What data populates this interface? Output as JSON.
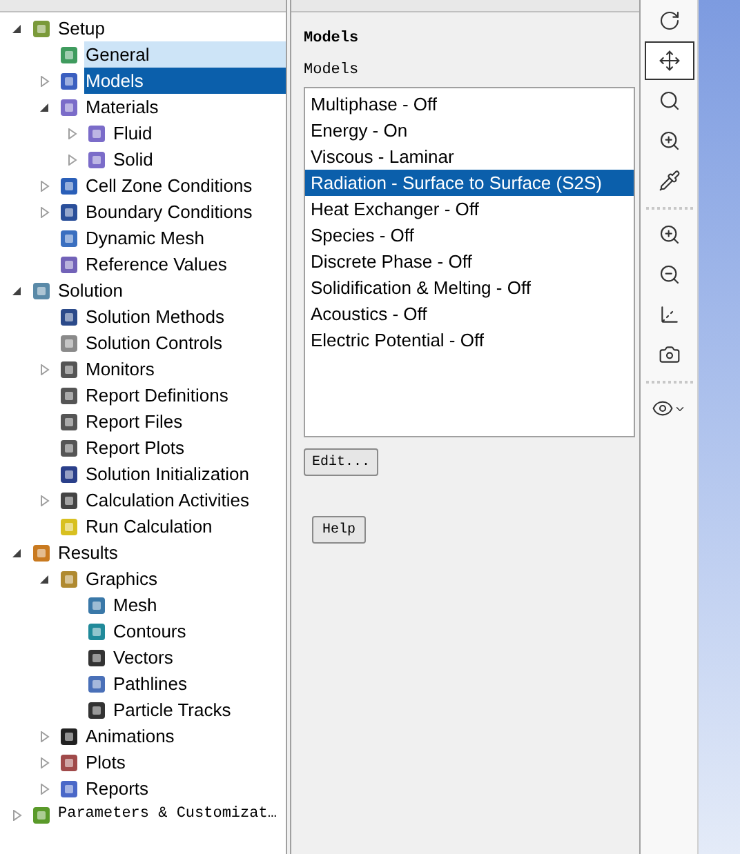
{
  "tree": [
    {
      "label": "Setup",
      "expanded": true,
      "selected": false,
      "hovered": false,
      "children": [
        {
          "label": "General",
          "selected": false,
          "hovered": true
        },
        {
          "label": "Models",
          "expanded": false,
          "selected": true,
          "hovered": false
        },
        {
          "label": "Materials",
          "expanded": true,
          "selected": false,
          "hovered": false,
          "children": [
            {
              "label": "Fluid",
              "expanded": false,
              "selected": false,
              "hovered": false
            },
            {
              "label": "Solid",
              "expanded": false,
              "selected": false,
              "hovered": false
            }
          ]
        },
        {
          "label": "Cell Zone Conditions",
          "expanded": false,
          "selected": false,
          "hovered": false
        },
        {
          "label": "Boundary Conditions",
          "expanded": false,
          "selected": false,
          "hovered": false
        },
        {
          "label": "Dynamic Mesh",
          "selected": false,
          "hovered": false
        },
        {
          "label": "Reference Values",
          "selected": false,
          "hovered": false
        }
      ]
    },
    {
      "label": "Solution",
      "expanded": true,
      "selected": false,
      "hovered": false,
      "children": [
        {
          "label": "Solution Methods",
          "selected": false,
          "hovered": false
        },
        {
          "label": "Solution Controls",
          "selected": false,
          "hovered": false
        },
        {
          "label": "Monitors",
          "expanded": false,
          "selected": false,
          "hovered": false
        },
        {
          "label": "Report Definitions",
          "selected": false,
          "hovered": false
        },
        {
          "label": "Report Files",
          "selected": false,
          "hovered": false
        },
        {
          "label": "Report Plots",
          "selected": false,
          "hovered": false
        },
        {
          "label": "Solution Initialization",
          "selected": false,
          "hovered": false
        },
        {
          "label": "Calculation Activities",
          "expanded": false,
          "selected": false,
          "hovered": false
        },
        {
          "label": "Run Calculation",
          "selected": false,
          "hovered": false
        }
      ]
    },
    {
      "label": "Results",
      "expanded": true,
      "selected": false,
      "hovered": false,
      "children": [
        {
          "label": "Graphics",
          "expanded": true,
          "selected": false,
          "hovered": false,
          "children": [
            {
              "label": "Mesh",
              "selected": false,
              "hovered": false
            },
            {
              "label": "Contours",
              "selected": false,
              "hovered": false
            },
            {
              "label": "Vectors",
              "selected": false,
              "hovered": false
            },
            {
              "label": "Pathlines",
              "selected": false,
              "hovered": false
            },
            {
              "label": "Particle Tracks",
              "selected": false,
              "hovered": false
            }
          ]
        },
        {
          "label": "Animations",
          "expanded": false,
          "selected": false,
          "hovered": false
        },
        {
          "label": "Plots",
          "expanded": false,
          "selected": false,
          "hovered": false
        },
        {
          "label": "Reports",
          "expanded": false,
          "selected": false,
          "hovered": false
        }
      ]
    },
    {
      "label": "Parameters & Customizat…",
      "expanded": false,
      "selected": false,
      "hovered": false,
      "kind": "mono"
    }
  ],
  "task_page": {
    "title": "Models",
    "list_label": "Models",
    "models": [
      {
        "label": "Multiphase - Off",
        "selected": false
      },
      {
        "label": "Energy - On",
        "selected": false
      },
      {
        "label": "Viscous - Laminar",
        "selected": false
      },
      {
        "label": "Radiation - Surface to Surface (S2S)",
        "selected": true
      },
      {
        "label": "Heat Exchanger - Off",
        "selected": false
      },
      {
        "label": "Species - Off",
        "selected": false
      },
      {
        "label": "Discrete Phase - Off",
        "selected": false
      },
      {
        "label": "Solidification & Melting - Off",
        "selected": false
      },
      {
        "label": "Acoustics - Off",
        "selected": false
      },
      {
        "label": "Electric Potential - Off",
        "selected": false
      }
    ],
    "buttons": [
      "Edit...",
      "Help"
    ]
  },
  "toolbar": [
    {
      "kind": "rotate",
      "selected": false
    },
    {
      "kind": "pan",
      "selected": true
    },
    {
      "kind": "zoom-fit",
      "selected": false
    },
    {
      "kind": "zoom-in",
      "selected": false
    },
    {
      "kind": "probe",
      "selected": false
    },
    {
      "kind": "separator"
    },
    {
      "kind": "zoom-box",
      "selected": false
    },
    {
      "kind": "zoom-out",
      "selected": false
    },
    {
      "kind": "axes",
      "selected": false
    },
    {
      "kind": "camera",
      "selected": false
    },
    {
      "kind": "separator"
    },
    {
      "kind": "view-menu",
      "selected": false
    }
  ]
}
